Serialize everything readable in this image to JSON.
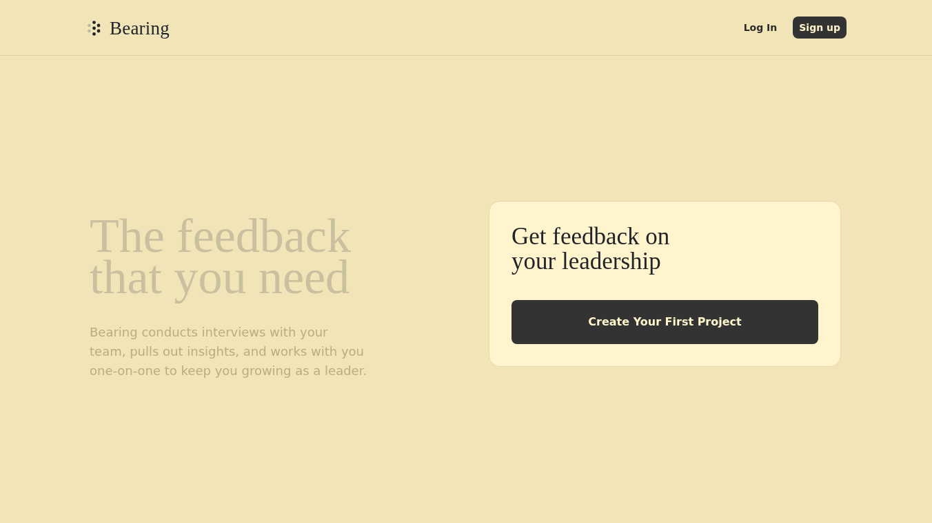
{
  "header": {
    "brand": "Bearing",
    "nav": [
      {
        "kind": "link",
        "label": "Log In"
      },
      {
        "kind": "button",
        "label": "Sign up"
      }
    ]
  },
  "hero": {
    "title": "The feedback that you need",
    "text_lines": [
      "Bearing conducts interviews with your",
      "team, pulls out insights, and works with you",
      "one-on-one to keep you growing as a leader."
    ]
  },
  "card": {
    "title": "Get feedback on your leadership",
    "button": "Create Your First Project"
  }
}
